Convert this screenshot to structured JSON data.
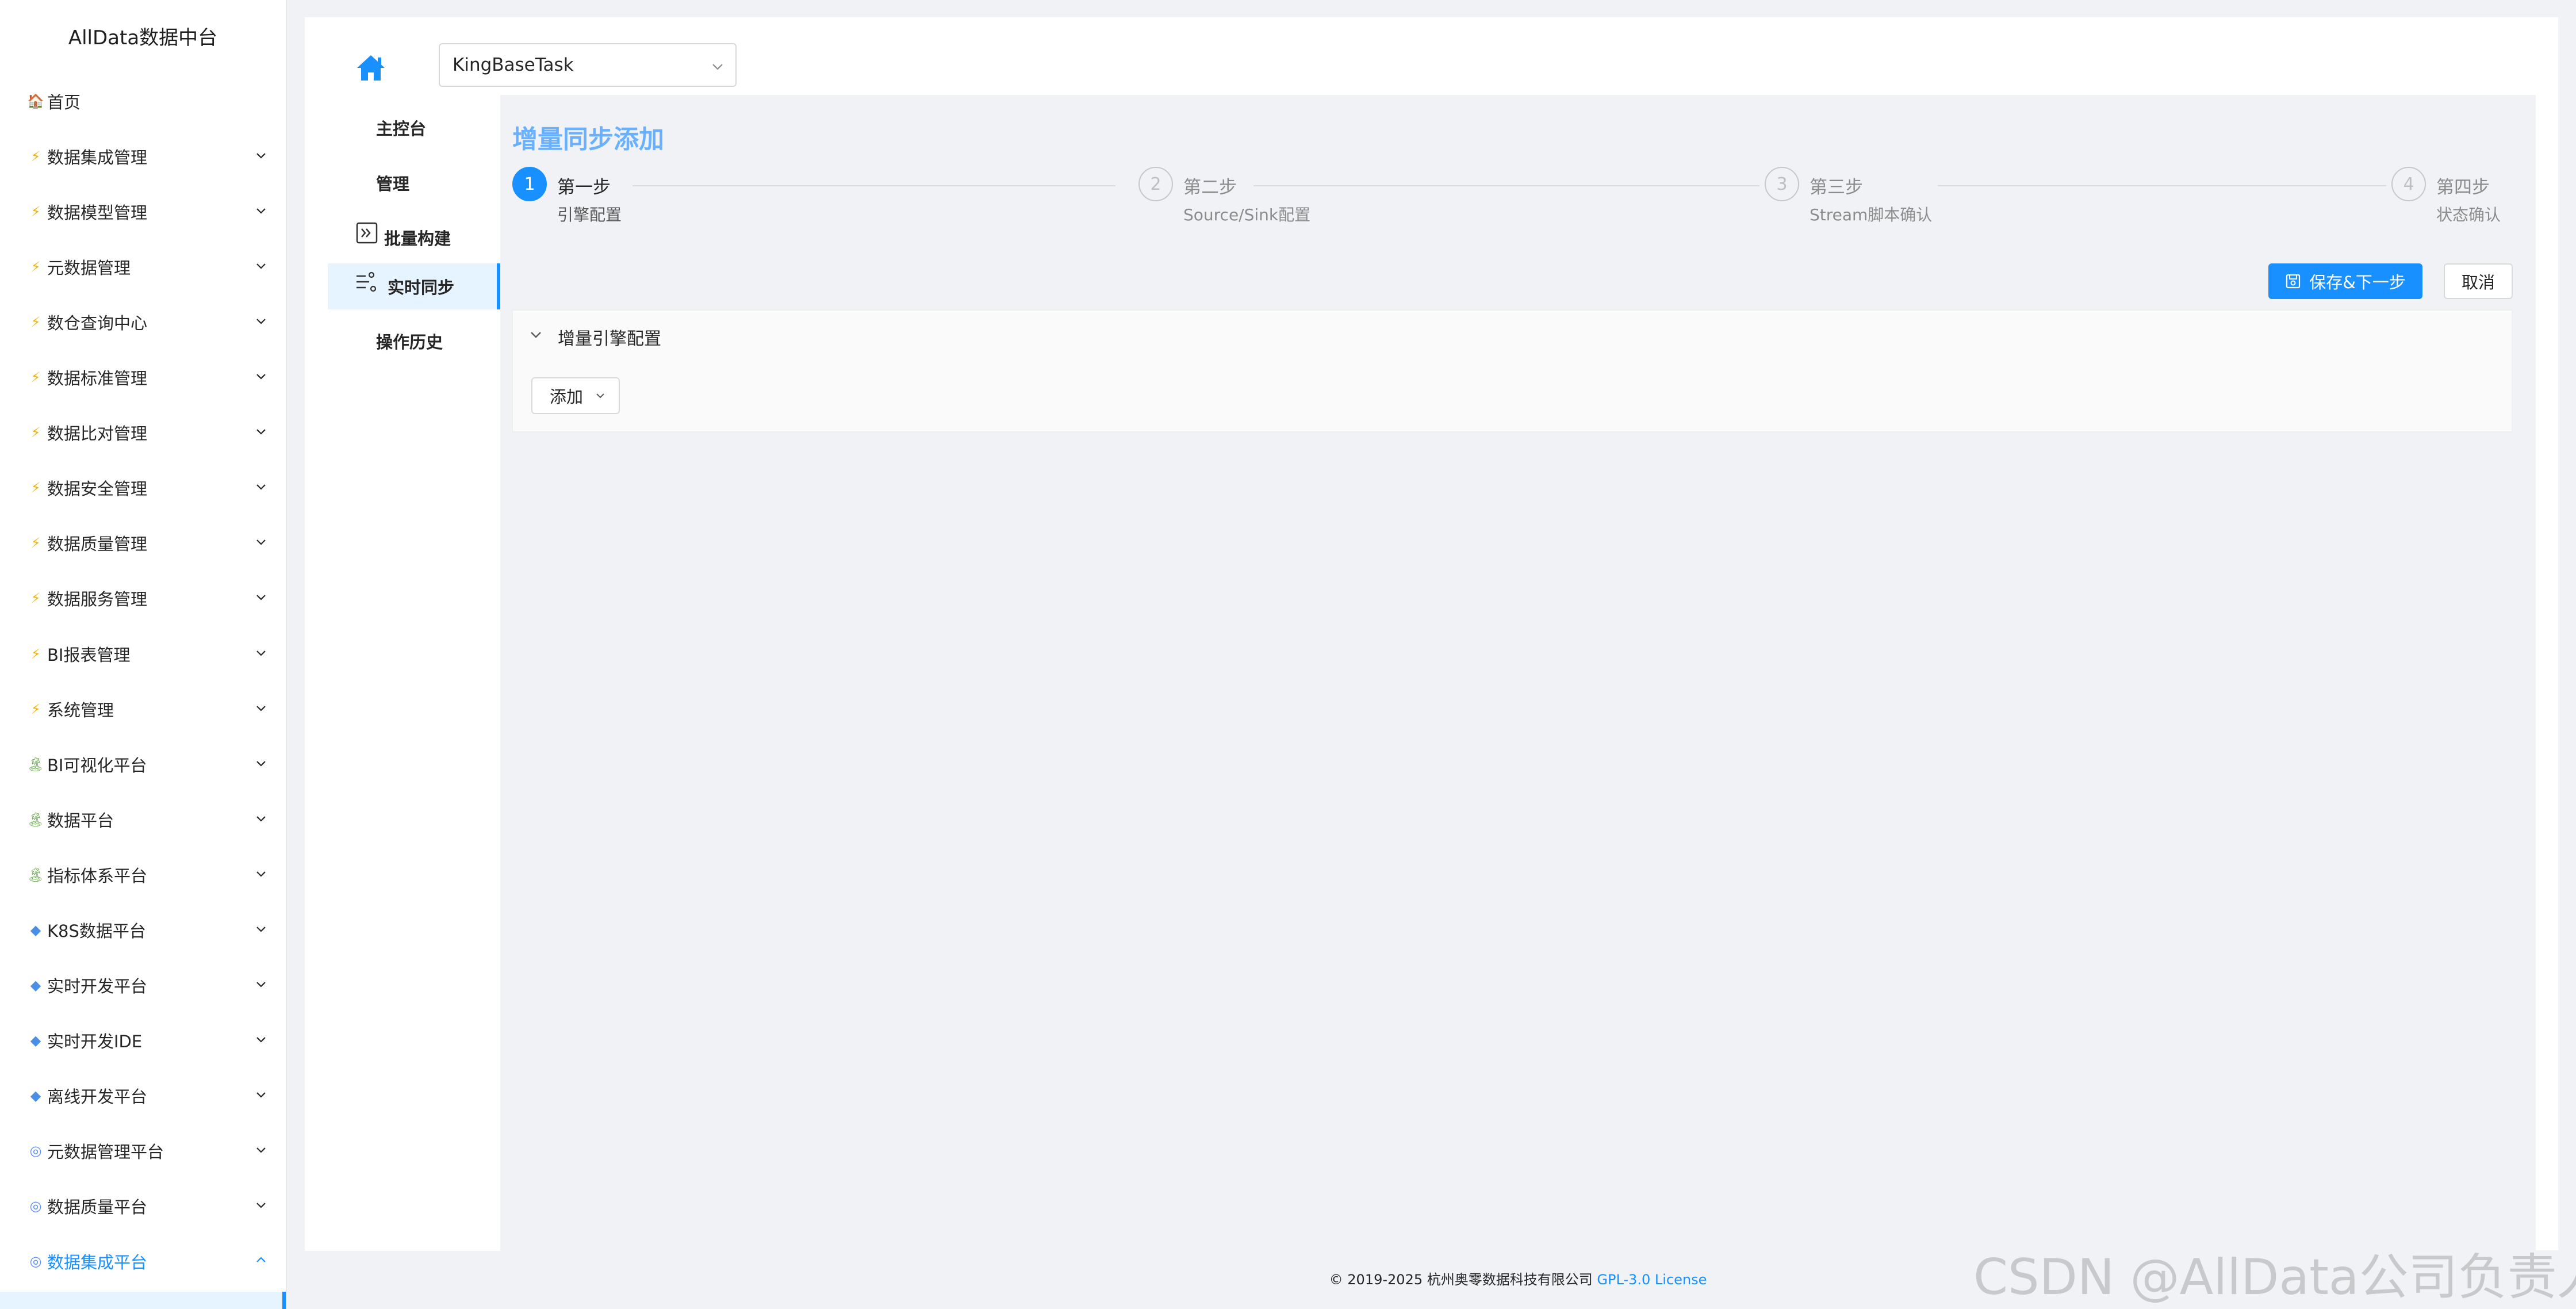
{
  "app": {
    "title": "AllData数据中台"
  },
  "sidebar": {
    "items": [
      {
        "label": "首页",
        "icon": "home-emoji-icon",
        "expandable": false
      },
      {
        "label": "数据集成管理",
        "icon": "bolt-icon",
        "expandable": true
      },
      {
        "label": "数据模型管理",
        "icon": "bolt-icon",
        "expandable": true
      },
      {
        "label": "元数据管理",
        "icon": "bolt-icon",
        "expandable": true
      },
      {
        "label": "数仓查询中心",
        "icon": "bolt-icon",
        "expandable": true
      },
      {
        "label": "数据标准管理",
        "icon": "bolt-icon",
        "expandable": true
      },
      {
        "label": "数据比对管理",
        "icon": "bolt-icon",
        "expandable": true
      },
      {
        "label": "数据安全管理",
        "icon": "bolt-icon",
        "expandable": true
      },
      {
        "label": "数据质量管理",
        "icon": "bolt-icon",
        "expandable": true
      },
      {
        "label": "数据服务管理",
        "icon": "bolt-icon",
        "expandable": true
      },
      {
        "label": "BI报表管理",
        "icon": "bolt-icon",
        "expandable": true
      },
      {
        "label": "系统管理",
        "icon": "bolt-icon",
        "expandable": true
      },
      {
        "label": "BI可视化平台",
        "icon": "tree-icon",
        "expandable": true
      },
      {
        "label": "数据平台",
        "icon": "tree-icon",
        "expandable": true
      },
      {
        "label": "指标体系平台",
        "icon": "tree-icon",
        "expandable": true
      },
      {
        "label": "K8S数据平台",
        "icon": "gem-icon",
        "expandable": true
      },
      {
        "label": "实时开发平台",
        "icon": "gem-icon",
        "expandable": true
      },
      {
        "label": "实时开发IDE",
        "icon": "gem-icon",
        "expandable": true
      },
      {
        "label": "离线开发平台",
        "icon": "gem-icon",
        "expandable": true
      },
      {
        "label": "元数据管理平台",
        "icon": "database-icon",
        "expandable": true
      },
      {
        "label": "数据质量平台",
        "icon": "database-icon",
        "expandable": true
      },
      {
        "label": "数据集成平台",
        "icon": "database-icon",
        "expandable": true,
        "active": true,
        "expanded": true
      }
    ]
  },
  "header": {
    "home_icon": "home-icon",
    "task_select": {
      "value": "KingBaseTask"
    }
  },
  "subnav": {
    "items": [
      {
        "label": "主控台"
      },
      {
        "label": "管理"
      },
      {
        "label": "批量构建",
        "icon": "batch-icon"
      },
      {
        "label": "实时同步",
        "icon": "sync-icon",
        "active": true
      },
      {
        "label": "操作历史"
      }
    ]
  },
  "main": {
    "title": "增量同步添加",
    "steps": [
      {
        "number": "1",
        "title": "第一步",
        "description": "引擎配置",
        "active": true
      },
      {
        "number": "2",
        "title": "第二步",
        "description": "Source/Sink配置"
      },
      {
        "number": "3",
        "title": "第三步",
        "description": "Stream脚本确认"
      },
      {
        "number": "4",
        "title": "第四步",
        "description": "状态确认"
      }
    ],
    "save_button": "保存&下一步",
    "cancel_button": "取消",
    "panel": {
      "title": "增量引擎配置",
      "add_button": "添加"
    }
  },
  "footer": {
    "copyright": "© 2019-2025 杭州奥零数据科技有限公司",
    "license": "GPL-3.0 License"
  },
  "watermark": "CSDN @AllData公司负责人",
  "colors": {
    "accent": "#1890ff",
    "title": "#69b1ff",
    "background": "#f0f2f5"
  }
}
